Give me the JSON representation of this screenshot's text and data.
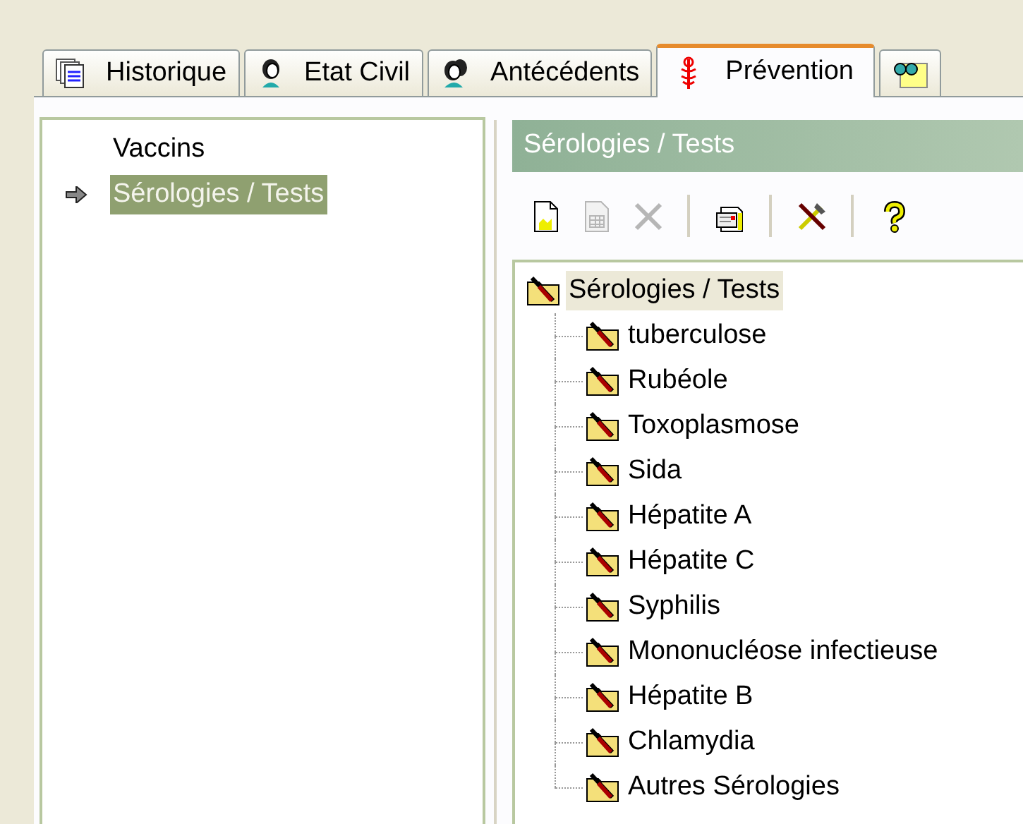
{
  "tabs": [
    {
      "label": "Historique",
      "kind": "history",
      "selected": false
    },
    {
      "label": "Etat Civil",
      "kind": "person",
      "selected": false
    },
    {
      "label": "Antécédents",
      "kind": "people",
      "selected": false
    },
    {
      "label": "Prévention",
      "kind": "caduceus",
      "selected": true
    },
    {
      "kind": "glasses",
      "selected": false
    }
  ],
  "sidebar": {
    "items": [
      {
        "label": "Vaccins",
        "selected": false
      },
      {
        "label": "Sérologies / Tests",
        "selected": true
      }
    ]
  },
  "panel": {
    "title": "Sérologies / Tests",
    "toolbar": [
      {
        "kind": "new",
        "disabled": false
      },
      {
        "kind": "sheet",
        "disabled": true
      },
      {
        "kind": "delete",
        "disabled": true
      },
      {
        "kind": "separator"
      },
      {
        "kind": "print",
        "disabled": false
      },
      {
        "kind": "separator"
      },
      {
        "kind": "tools",
        "disabled": false
      },
      {
        "kind": "separator"
      },
      {
        "kind": "help",
        "disabled": false
      }
    ],
    "tree": [
      {
        "label": "Sérologies / Tests",
        "selected": true,
        "expanded": true,
        "children": [
          {
            "label": "tuberculose",
            "selected": false
          },
          {
            "label": "Rubéole",
            "selected": false
          },
          {
            "label": "Toxoplasmose",
            "selected": false
          },
          {
            "label": "Sida",
            "selected": false
          },
          {
            "label": "Hépatite A",
            "selected": false
          },
          {
            "label": "Hépatite C",
            "selected": false
          },
          {
            "label": "Syphilis",
            "selected": false
          },
          {
            "label": "Mononucléose infectieuse",
            "selected": false
          },
          {
            "label": "Hépatite B",
            "selected": false
          },
          {
            "label": "Chlamydia",
            "selected": false
          },
          {
            "label": "Autres Sérologies",
            "selected": false
          }
        ]
      }
    ]
  }
}
